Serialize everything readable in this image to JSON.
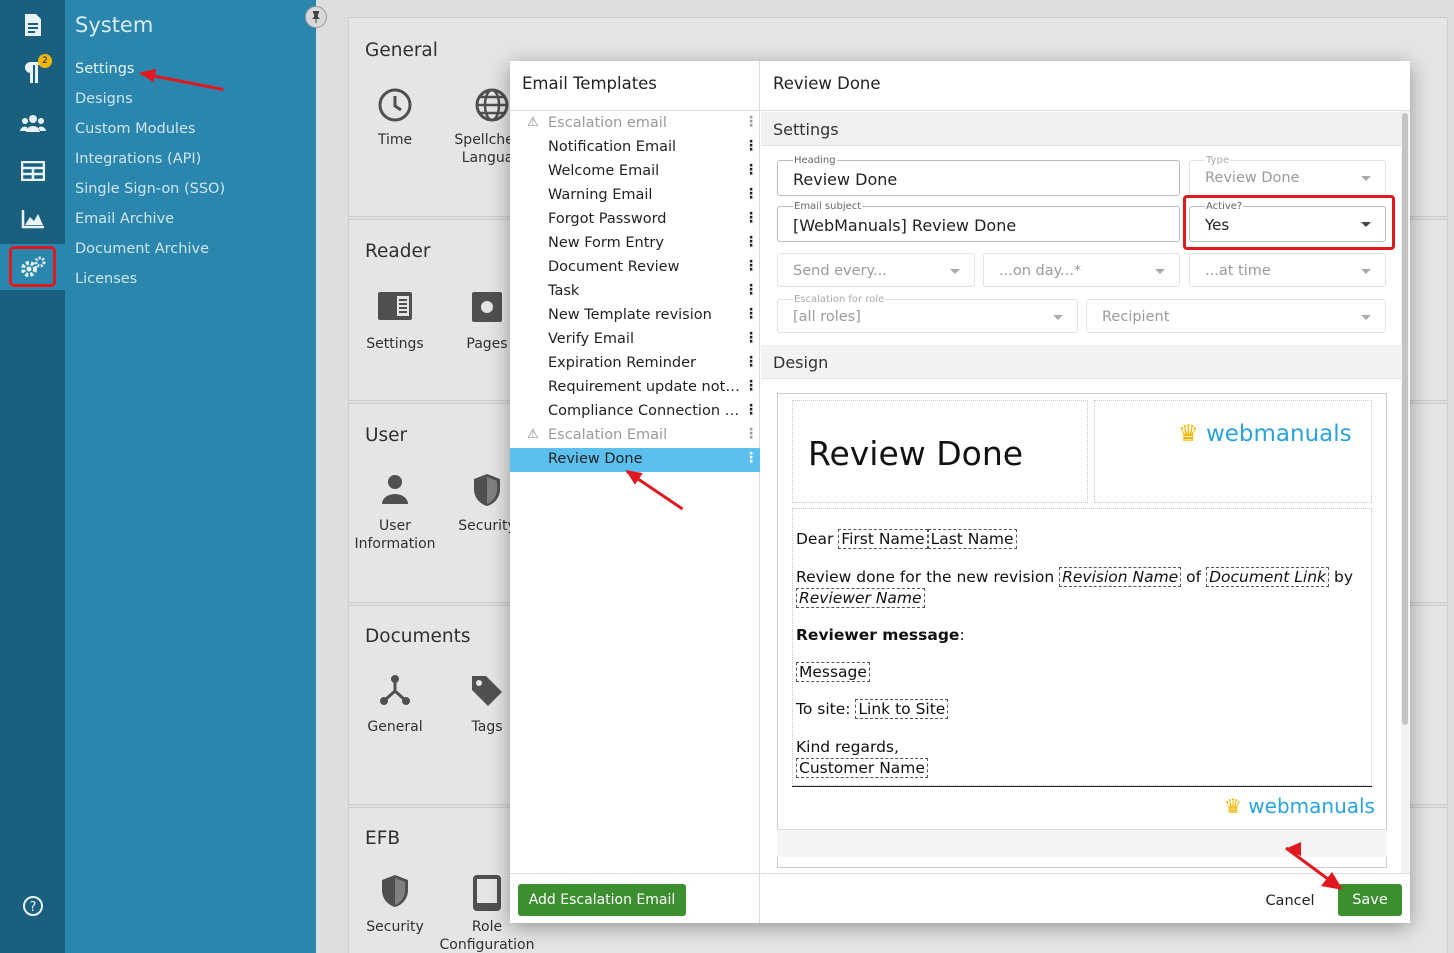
{
  "sidebar": {
    "badge": "2",
    "title": "System",
    "items": [
      "Settings",
      "Designs",
      "Custom Modules",
      "Integrations (API)",
      "Single Sign-on (SSO)",
      "Email Archive",
      "Document Archive",
      "Licenses"
    ]
  },
  "cards": [
    {
      "title": "General",
      "tiles": [
        "Time",
        "Spellcheck Languag"
      ]
    },
    {
      "title": "Reader",
      "tiles": [
        "Settings",
        "Pages"
      ]
    },
    {
      "title": "User",
      "tiles": [
        "User Information",
        "Security"
      ]
    },
    {
      "title": "Documents",
      "tiles": [
        "General",
        "Tags"
      ]
    },
    {
      "title": "EFB",
      "tiles": [
        "Security",
        "Role Configuration"
      ]
    }
  ],
  "email_templates": {
    "title": "Email Templates",
    "items": [
      "Escalation email",
      "Notification Email",
      "Welcome Email",
      "Warning Email",
      "Forgot Password",
      "New Form Entry",
      "Document Review",
      "Task",
      "New Template revision",
      "Verify Email",
      "Expiration Reminder",
      "Requirement update notific...",
      "Compliance Connection No...",
      "Escalation Email",
      "Review Done"
    ],
    "selected": "Review Done",
    "add_button": "Add Escalation Email"
  },
  "detail": {
    "title": "Review Done",
    "settings_label": "Settings",
    "heading": {
      "label": "Heading",
      "value": "Review Done"
    },
    "type": {
      "label": "Type",
      "value": "Review Done"
    },
    "email_subject": {
      "label": "Email subject",
      "value": "[WebManuals] Review Done"
    },
    "active": {
      "label": "Active?",
      "value": "Yes"
    },
    "send_every": {
      "placeholder": "Send every..."
    },
    "on_day": {
      "placeholder": "...on day...*"
    },
    "at_time": {
      "placeholder": "...at time"
    },
    "escalation_role": {
      "label": "Escalation for role",
      "value": "[all roles]"
    },
    "recipient": {
      "placeholder": "Recipient"
    },
    "design_label": "Design",
    "cancel": "Cancel",
    "save": "Save"
  },
  "email_preview": {
    "title": "Review Done",
    "logo_text": "webmanuals",
    "dear": "Dear",
    "first_name": "First Name",
    "last_name": "Last Name",
    "review_text": "Review done for the new revision",
    "revision_name": "Revision Name",
    "of": "of",
    "document_link": "Document Link",
    "by": "by",
    "reviewer_name": "Reviewer Name",
    "reviewer_message": "Reviewer message",
    "colon": ":",
    "message": "Message",
    "to_site": "To site:",
    "link_to_site": "Link to Site",
    "kind_regards": "Kind regards,",
    "customer_name": "Customer Name"
  },
  "colors": {
    "accent": "#3b8f2f",
    "selection": "#5bc0ee",
    "sidebar": "#2a86ad",
    "rail": "#1b5f7f",
    "annotation": "#e0191f"
  }
}
